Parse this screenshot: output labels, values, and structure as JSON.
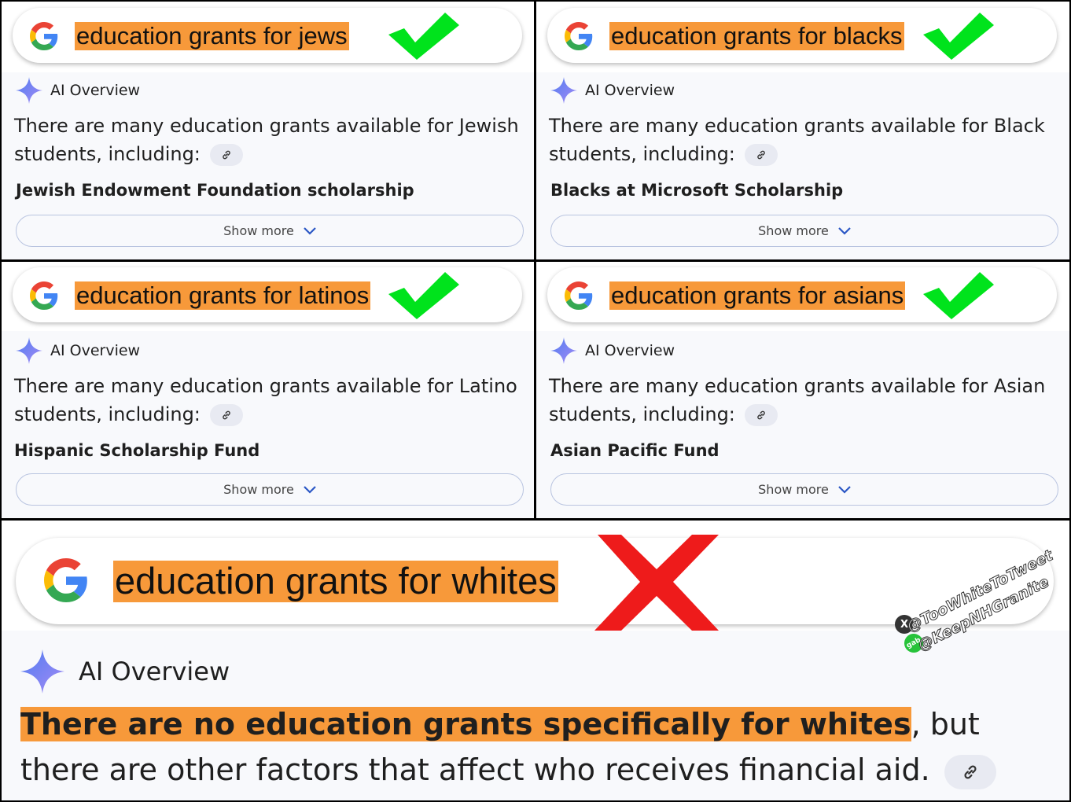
{
  "panels": [
    {
      "query": "education grants for jews",
      "ai_label": "AI Overview",
      "body": "There are many education grants available for Jewish students, including:",
      "item": "Jewish Endowment Foundation scholarship",
      "show_more": "Show more"
    },
    {
      "query": "education grants for blacks",
      "ai_label": "AI Overview",
      "body": "There are many education grants available for Black students, including:",
      "item": "Blacks at Microsoft Scholarship",
      "show_more": "Show more"
    },
    {
      "query": "education grants for latinos",
      "ai_label": "AI Overview",
      "body": "There are many education grants available for Latino students, including:",
      "item": "Hispanic Scholarship Fund",
      "show_more": "Show more"
    },
    {
      "query": "education grants for asians",
      "ai_label": "AI Overview",
      "body": "There are many education grants available for Asian students, including:",
      "item": "Asian Pacific Fund",
      "show_more": "Show more"
    }
  ],
  "bottom": {
    "query": "education grants for whites",
    "ai_label": "AI Overview",
    "highlight": "There are no education grants specifically for whites",
    "rest": ", but there are other factors that affect who receives financial aid."
  },
  "watermark": {
    "line1": "@TooWhiteToTweet",
    "line2": "@KeepNHGranite",
    "x_badge": "X",
    "gab_badge": "gab"
  },
  "colors": {
    "highlight": "#f7993a",
    "check": "#00e31c",
    "cross": "#ee1b1b",
    "divider": "#000000"
  },
  "icons": {
    "google": "google-logo-icon",
    "sparkle": "ai-sparkle-icon",
    "link": "link-icon",
    "chevron": "chevron-down-icon",
    "check": "checkmark-icon",
    "cross": "cross-icon"
  }
}
